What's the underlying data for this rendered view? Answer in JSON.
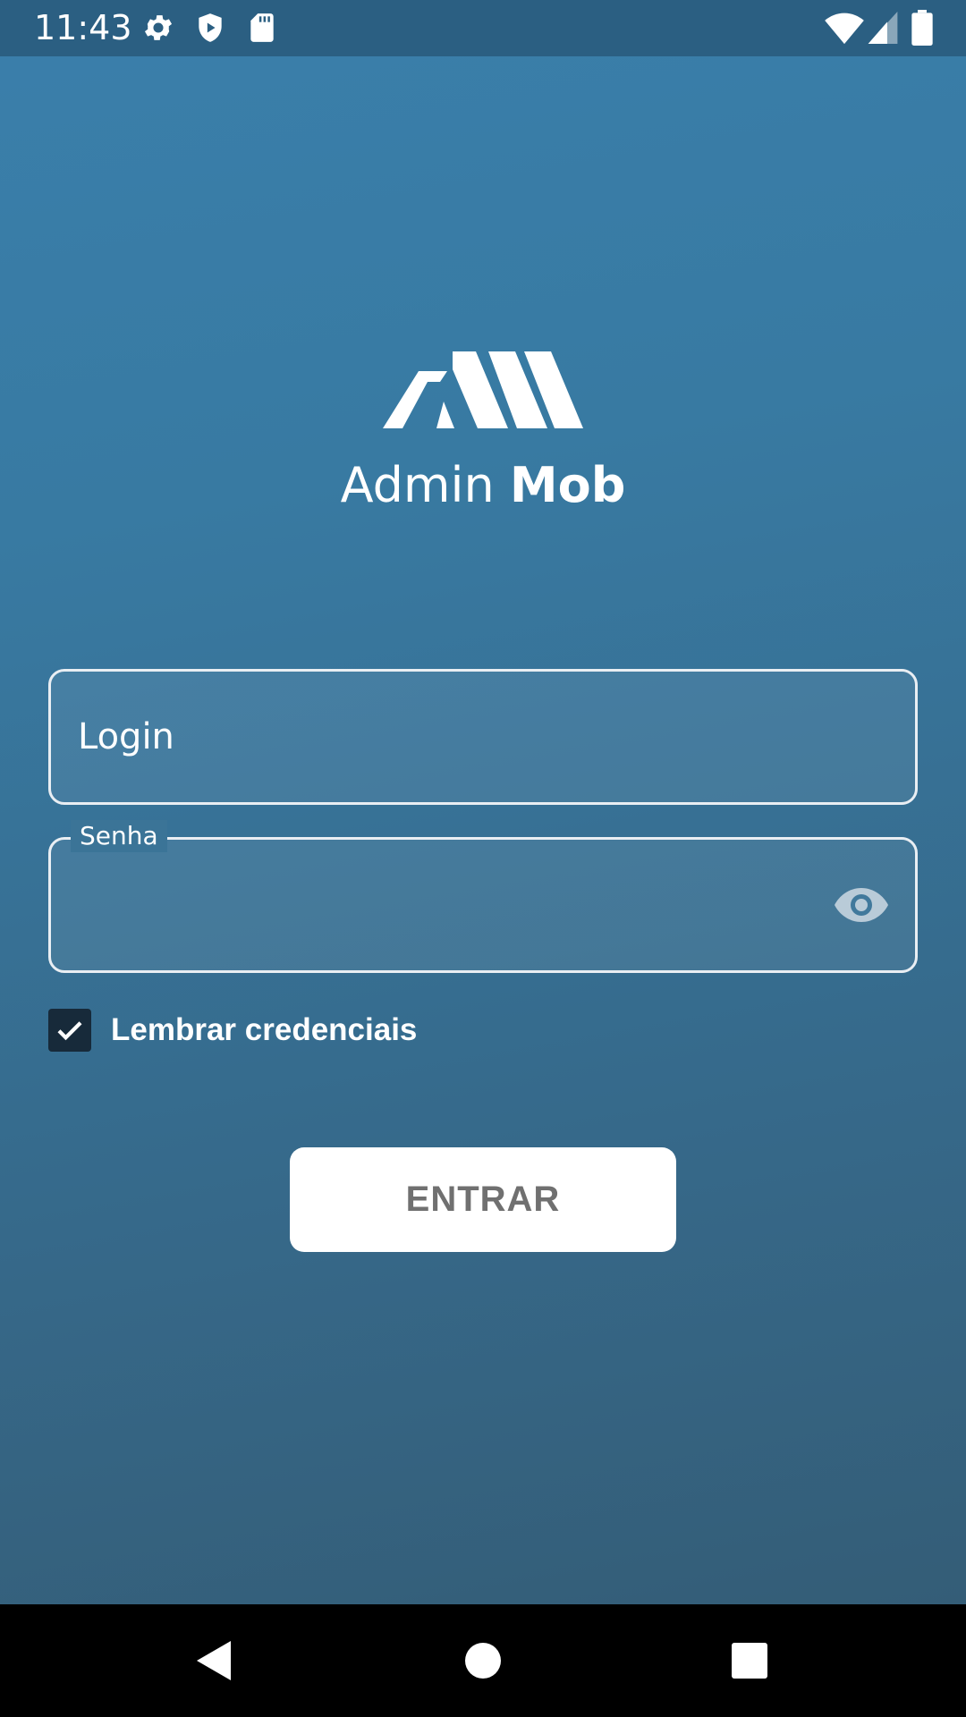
{
  "status_bar": {
    "time": "11:43",
    "icons": [
      "settings-icon",
      "shield-icon",
      "sd-card-icon",
      "wifi-icon",
      "signal-icon",
      "battery-icon"
    ]
  },
  "app": {
    "title_regular": "Admin",
    "title_bold": "Mob"
  },
  "login_field": {
    "placeholder": "Login",
    "value": ""
  },
  "password_field": {
    "label": "Senha",
    "value": "",
    "toggle_icon": "eye-icon"
  },
  "remember": {
    "label": "Lembrar credenciais",
    "checked": true
  },
  "submit": {
    "label": "ENTRAR"
  },
  "navigation": {
    "icons": [
      "back-icon",
      "home-icon",
      "recents-icon"
    ]
  },
  "colors": {
    "status_bar": "#2b5f82",
    "background_top": "#3a7fab",
    "background_bottom": "#345d77",
    "button_text": "#707070",
    "checkbox": "#172a3a"
  }
}
